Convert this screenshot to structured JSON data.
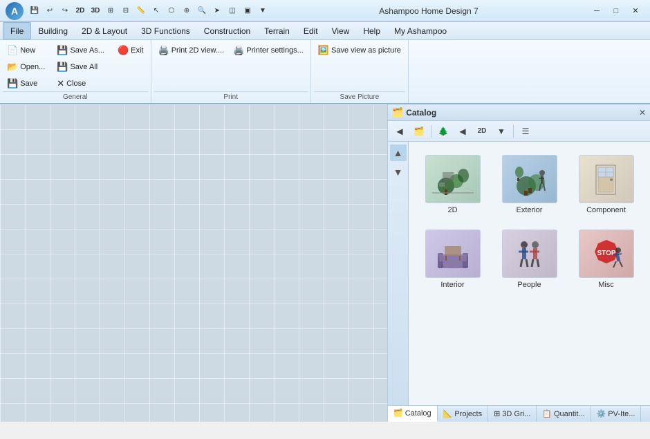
{
  "titlebar": {
    "app_title": "Ashampoo Home Design 7",
    "logo_letter": "A",
    "quick_access": [
      "↩",
      "↪",
      "⬜",
      "⊞",
      "▣",
      "⊟",
      "⊕",
      "⊞",
      "⊟",
      "|",
      "➤",
      "◻",
      "⊡",
      "◫",
      "➤",
      "⬡"
    ],
    "win_min": "─",
    "win_max": "□",
    "win_close": "✕"
  },
  "menubar": {
    "items": [
      {
        "label": "File",
        "active": true
      },
      {
        "label": "Building"
      },
      {
        "label": "2D & Layout"
      },
      {
        "label": "3D Functions"
      },
      {
        "label": "Construction"
      },
      {
        "label": "Terrain"
      },
      {
        "label": "Edit"
      },
      {
        "label": "View"
      },
      {
        "label": "Help"
      },
      {
        "label": "My Ashampoo"
      }
    ]
  },
  "ribbon": {
    "groups": [
      {
        "name": "General",
        "buttons": [
          {
            "label": "New",
            "icon": "📄",
            "class": "ico-new"
          },
          {
            "label": "Open...",
            "icon": "📂",
            "class": "ico-open"
          },
          {
            "label": "Save",
            "icon": "💾",
            "class": "ico-save"
          }
        ],
        "extra_buttons": [
          {
            "label": "Save As...",
            "icon": "💾",
            "class": "ico-save"
          },
          {
            "label": "Save All",
            "icon": "💾",
            "class": "ico-save"
          },
          {
            "label": "Close",
            "icon": "✕",
            "class": ""
          }
        ],
        "exit_button": {
          "label": "Exit",
          "icon": "🔴"
        }
      },
      {
        "name": "Print",
        "buttons": [
          {
            "label": "Print 2D view....",
            "icon": "🖨️"
          },
          {
            "label": "Printer settings...",
            "icon": "🖨️"
          }
        ]
      },
      {
        "name": "Save Picture",
        "buttons": [
          {
            "label": "Save view as picture",
            "icon": "🖼️"
          }
        ]
      }
    ]
  },
  "catalog": {
    "title": "Catalog",
    "items": [
      {
        "label": "2D",
        "thumb_class": "thumb-2d",
        "icon": "🌳"
      },
      {
        "label": "Exterior",
        "thumb_class": "thumb-ext",
        "icon": "🌿"
      },
      {
        "label": "Component",
        "thumb_class": "thumb-comp",
        "icon": "🚪"
      },
      {
        "label": "Interior",
        "thumb_class": "thumb-int",
        "icon": "🛋️"
      },
      {
        "label": "People",
        "thumb_class": "thumb-ppl",
        "icon": "🚶"
      },
      {
        "label": "Misc",
        "thumb_class": "thumb-misc",
        "icon": "⛔"
      }
    ]
  },
  "bottom_tabs": [
    {
      "label": "Catalog",
      "icon": "🗂️",
      "active": true
    },
    {
      "label": "Projects",
      "icon": "📐"
    },
    {
      "label": "3D Gri...",
      "icon": "⊞"
    },
    {
      "label": "Quantit...",
      "icon": "📋"
    },
    {
      "label": "PV-Ite...",
      "icon": "⚙️"
    }
  ],
  "toolbar": {
    "mode_2d": "2D",
    "mode_3d": "3D"
  }
}
